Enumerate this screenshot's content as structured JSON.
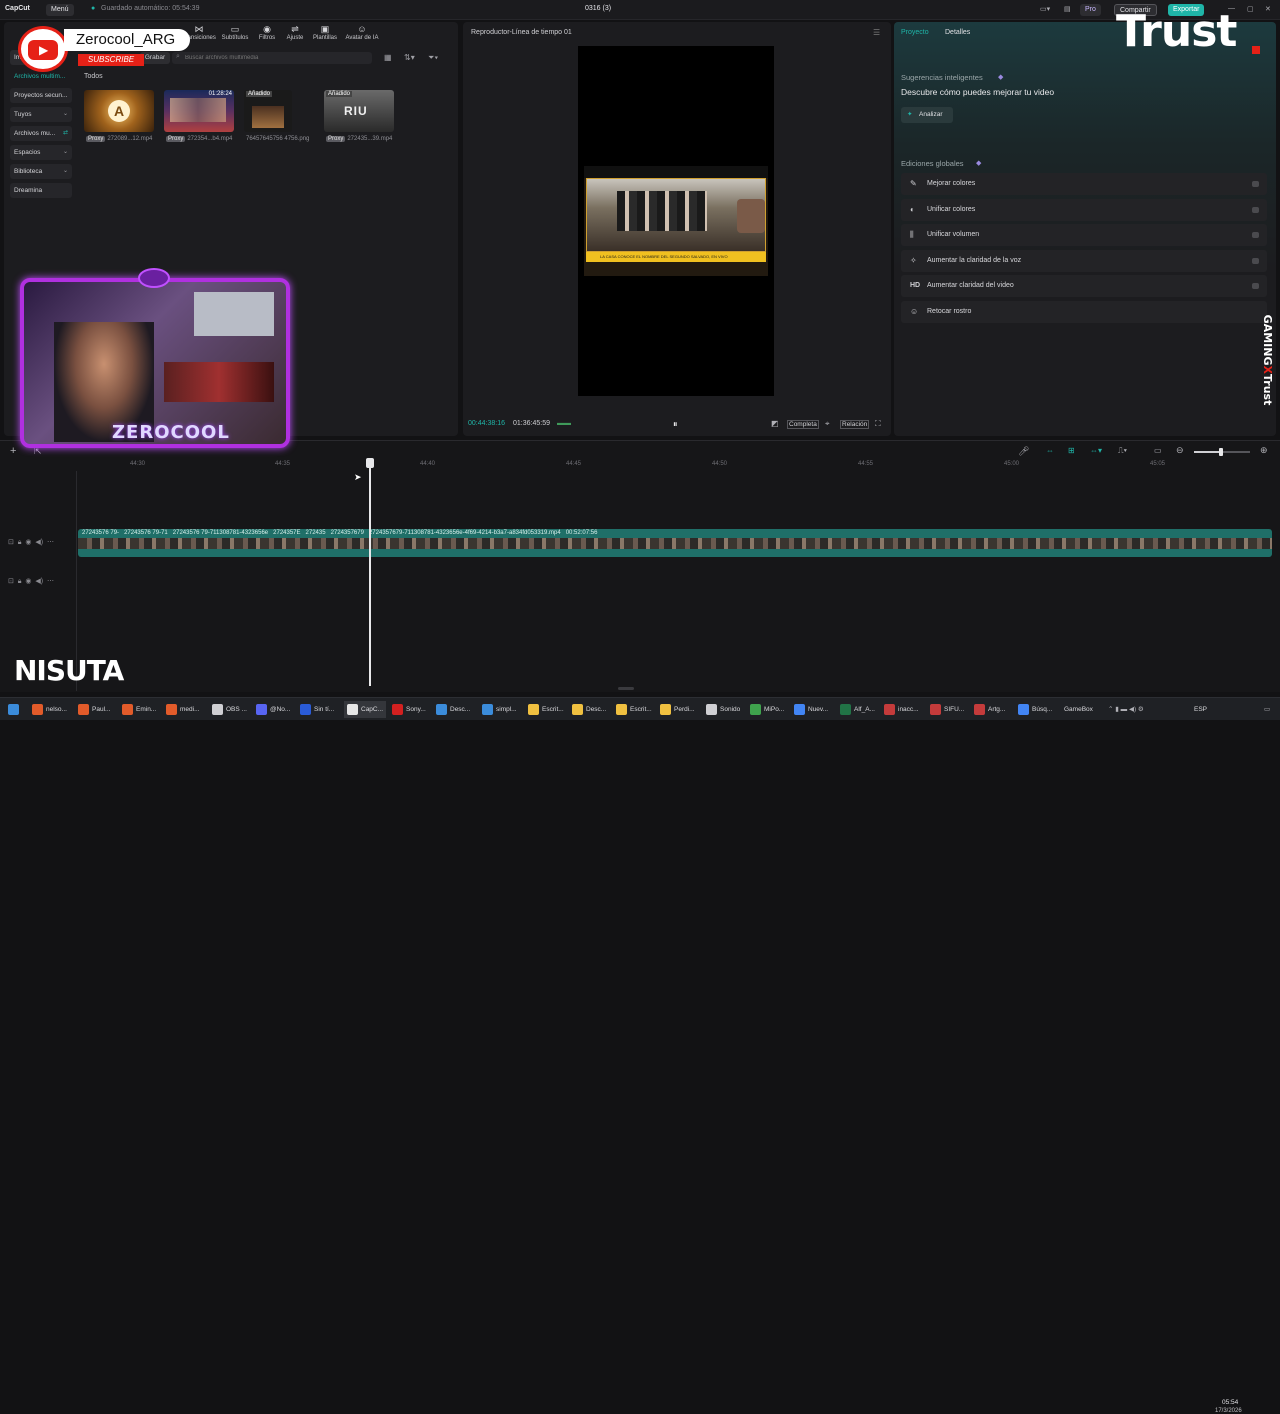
{
  "titlebar": {
    "app_name": "CapCut",
    "menu_label": "Menú",
    "autosave_text": "Guardado automático: 05:54:39",
    "project_title": "0316 (3)",
    "pro_label": "Pro",
    "share_label": "Compartir",
    "export_label": "Exportar"
  },
  "toolbar": {
    "items": [
      {
        "label": "Transiciones"
      },
      {
        "label": "Subtítulos"
      },
      {
        "label": "Filtros"
      },
      {
        "label": "Ajuste"
      },
      {
        "label": "Plantillas"
      },
      {
        "label": "Avatar de IA"
      }
    ]
  },
  "sidebar": {
    "import_label": "Im...",
    "media_label": "Archivos multim...",
    "items": [
      {
        "label": "Proyectos secun..."
      },
      {
        "label": "Tuyos"
      },
      {
        "label": "Archivos mu..."
      },
      {
        "label": "Espacios"
      },
      {
        "label": "Biblioteca"
      },
      {
        "label": "Dreamina"
      }
    ]
  },
  "media": {
    "record_label": "Grabar",
    "search_placeholder": "Buscar archivos multimedia",
    "section_label": "Todos",
    "items": [
      {
        "name": "272089...12.mp4",
        "tag": "Proxy",
        "duration": "",
        "badge": ""
      },
      {
        "name": "272354...b4.mp4",
        "tag": "Proxy",
        "duration": "01:28:24",
        "badge": ""
      },
      {
        "name": "76457645756 4756.png",
        "tag": "",
        "duration": "",
        "badge": "Añadido"
      },
      {
        "name": "272435...39.mp4",
        "tag": "Proxy",
        "duration": "",
        "badge": "Añadido"
      }
    ]
  },
  "player": {
    "title": "Reproductor-Línea de tiempo 01",
    "current_time": "00:44:38:16",
    "total_time": "01:36:45:59",
    "quality_label": "Completa",
    "ratio_label": "Relación",
    "video_caption": "LA CASA CONOCE EL NOMBRE DEL SEGUNDO SALVADO, EN VIVO"
  },
  "right_panel": {
    "tab_project": "Proyecto",
    "tab_details": "Detalles",
    "suggestions_title": "Sugerencias inteligentes",
    "suggestions_subtitle": "Descubre cómo puedes mejorar tu video",
    "analyze_label": "Analizar",
    "global_title": "Ediciones globales",
    "enhancements": [
      {
        "label": "Mejorar colores",
        "icon": "wand-icon"
      },
      {
        "label": "Unificar colores",
        "icon": "color-icon"
      },
      {
        "label": "Unificar volumen",
        "icon": "volume-bars-icon"
      },
      {
        "label": "Aumentar la claridad de la voz",
        "icon": "voice-icon"
      },
      {
        "label": "Aumentar claridad del video",
        "icon": "hd-icon"
      },
      {
        "label": "Retocar rostro",
        "icon": "face-icon"
      }
    ]
  },
  "timeline": {
    "ruler_ticks": [
      "44:30",
      "44:35",
      "44:40",
      "44:45",
      "44:50",
      "44:55",
      "45:00",
      "45:05"
    ],
    "clip_labels": [
      "27243576 79-",
      "27243576 79-71",
      "27243576 79-711308781-4323656e",
      "2724357E",
      "272435",
      "2724357679",
      "2724357679-711308781-4323656e-4f69-4214-b3a7-a834fd053319.mp4",
      "00:52:07:56"
    ]
  },
  "taskbar": {
    "items": [
      {
        "label": "nelso...",
        "color": "#e25b2a"
      },
      {
        "label": "Paul...",
        "color": "#e25b2a"
      },
      {
        "label": "Emin...",
        "color": "#e25b2a"
      },
      {
        "label": "medi...",
        "color": "#e25b2a"
      },
      {
        "label": "OBS ...",
        "color": "#cfcfd3"
      },
      {
        "label": "@No...",
        "color": "#5865f2"
      },
      {
        "label": "Sin tí...",
        "color": "#2a5bd7"
      },
      {
        "label": "CapC...",
        "color": "#e6e6e6"
      },
      {
        "label": "Sony...",
        "color": "#d32020"
      },
      {
        "label": "Desc...",
        "color": "#3b8cdb"
      },
      {
        "label": "simpl...",
        "color": "#3b8cdb"
      },
      {
        "label": "Escrit...",
        "color": "#f0c040"
      },
      {
        "label": "Desc...",
        "color": "#f0c040"
      },
      {
        "label": "Escrit...",
        "color": "#f0c040"
      },
      {
        "label": "Perdi...",
        "color": "#f0c040"
      },
      {
        "label": "Sonido",
        "color": "#cfcfd3"
      },
      {
        "label": "MiPo...",
        "color": "#3fa34d"
      },
      {
        "label": "Nuev...",
        "color": "#4285f4"
      },
      {
        "label": "Alf_A...",
        "color": "#217346"
      },
      {
        "label": "inacc...",
        "color": "#c43b3b"
      },
      {
        "label": "SIFU...",
        "color": "#c43b3b"
      },
      {
        "label": "Artg...",
        "color": "#c43b3b"
      },
      {
        "label": "Búsq...",
        "color": "#4285f4"
      }
    ],
    "gamebox_label": "GameBox",
    "lang": "ESP",
    "clock_time": "05:54",
    "clock_date": "17/3/2026"
  },
  "overlays": {
    "channel_name": "Zerocool_ARG",
    "subscribe_label": "SUBSCRIBE",
    "brand_trust": "Trust",
    "gaming_label": "GAMING",
    "gaming_x": "X",
    "gaming_trust": "Trust",
    "webcam_name": "ZEROCOOL",
    "sponsor": "NISUTA"
  },
  "colors": {
    "accent_teal": "#1fb5a8",
    "export_bg": "#1fb5a8",
    "clip_bg": "#1f6f68",
    "youtube_red": "#e62117"
  }
}
